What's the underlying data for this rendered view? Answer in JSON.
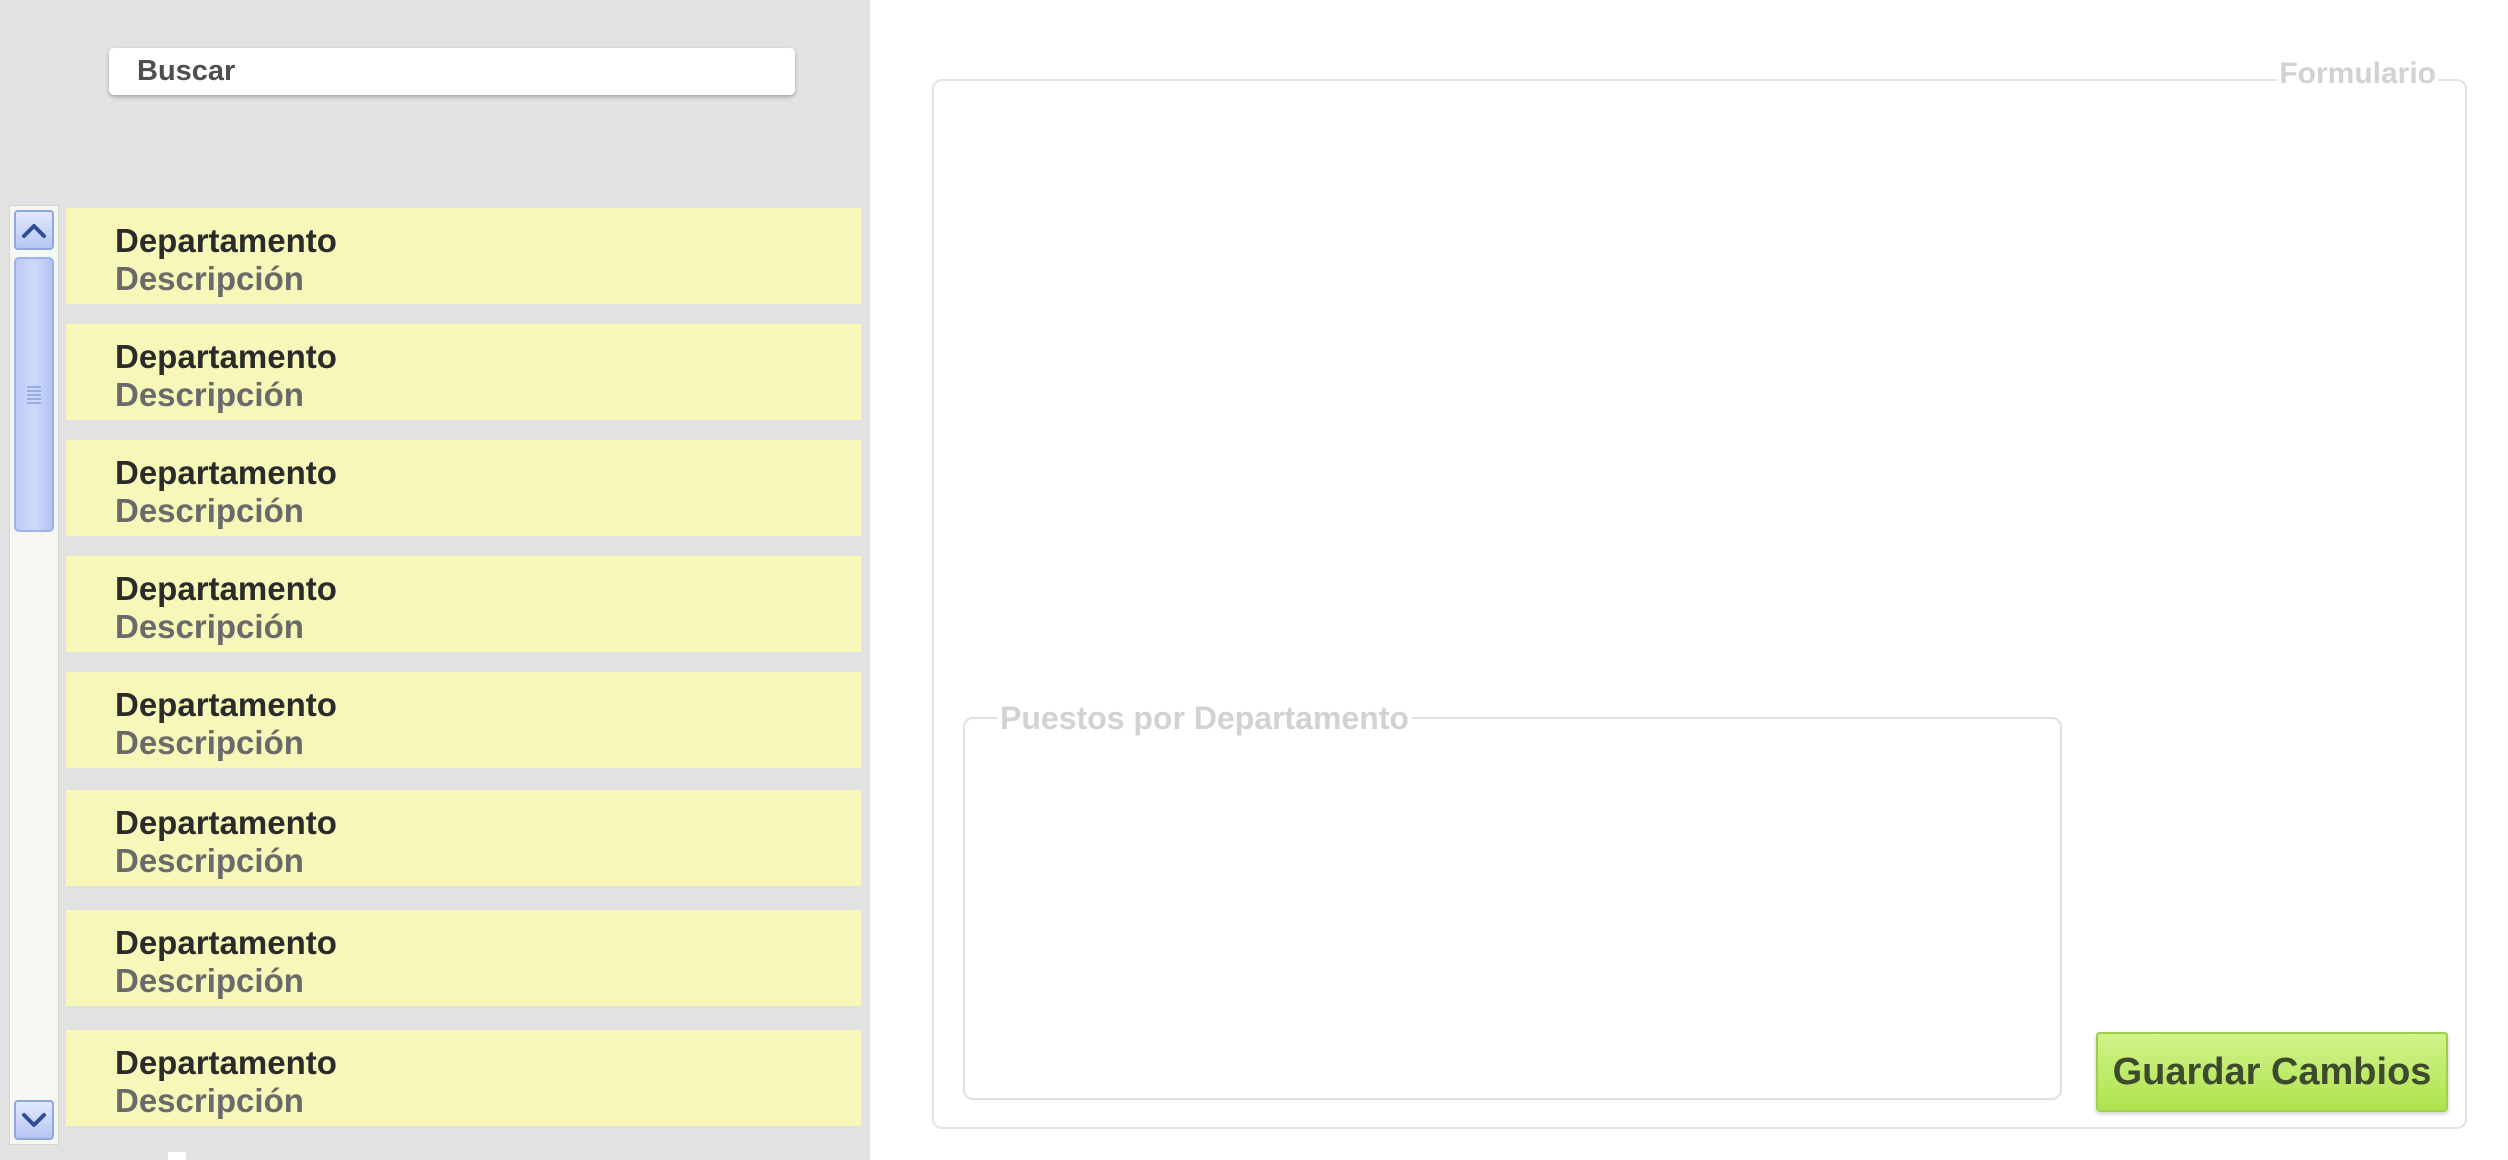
{
  "search": {
    "label": "Buscar"
  },
  "departments": [
    {
      "title": "Departamento",
      "description": "Descripción"
    },
    {
      "title": "Departamento",
      "description": "Descripción"
    },
    {
      "title": "Departamento",
      "description": "Descripción"
    },
    {
      "title": "Departamento",
      "description": "Descripción"
    },
    {
      "title": "Departamento",
      "description": "Descripción"
    },
    {
      "title": "Departamento",
      "description": "Descripción"
    },
    {
      "title": "Departamento",
      "description": "Descripción"
    },
    {
      "title": "Departamento",
      "description": "Descripción"
    }
  ],
  "form": {
    "legend": "Formulario",
    "puestos_legend": "Puestos por Departamento",
    "save_label": "Guardar Cambios"
  },
  "icons": {
    "scroll_up": "chevron-up-icon",
    "scroll_down": "chevron-down-icon",
    "thumb_grip": "grip-lines-icon"
  },
  "colors": {
    "sidebar_bg": "#e2e2e2",
    "list_item_bg": "#f6f7b8",
    "save_button": "#aee24e",
    "scrollbar_accent": "#b6c6f4"
  }
}
